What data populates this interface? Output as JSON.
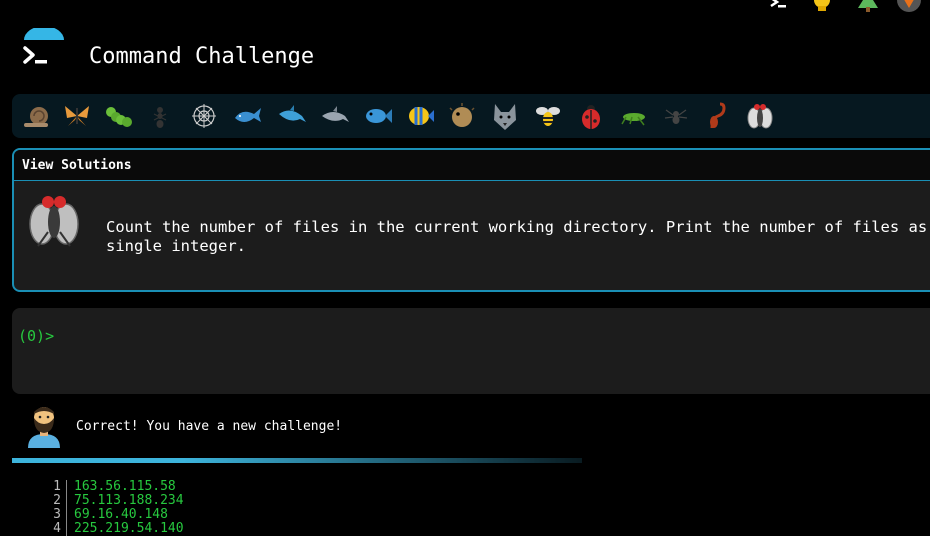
{
  "header": {
    "title": "Command Challenge"
  },
  "top_icons": [
    "terminal-icon",
    "lightbulb-icon",
    "tree-icon",
    "fox-icon"
  ],
  "animal_strip": [
    "snail",
    "butterfly",
    "caterpillar",
    "ant",
    "spider-web",
    "whale",
    "dolphin-blue",
    "dolphin-gray",
    "fish",
    "tropical-fish",
    "blowfish",
    "wolf",
    "bee",
    "ladybug",
    "cricket",
    "spider",
    "scorpion",
    "fly"
  ],
  "challenge": {
    "heading": "View Solutions",
    "line1": "Count the number of files in the current working directory. Print the number of files as a",
    "line2": "single integer."
  },
  "terminal": {
    "prompt": "(0)>"
  },
  "feedback": {
    "message": "Correct! You have a new challenge!"
  },
  "listing": [
    {
      "n": "1",
      "v": "163.56.115.58"
    },
    {
      "n": "2",
      "v": "75.113.188.234"
    },
    {
      "n": "3",
      "v": "69.16.40.148"
    },
    {
      "n": "4",
      "v": "225.219.54.140"
    }
  ],
  "colors": {
    "accent": "#1a8fb5",
    "prompt": "#27c93f",
    "panel": "#1c1c1c"
  }
}
